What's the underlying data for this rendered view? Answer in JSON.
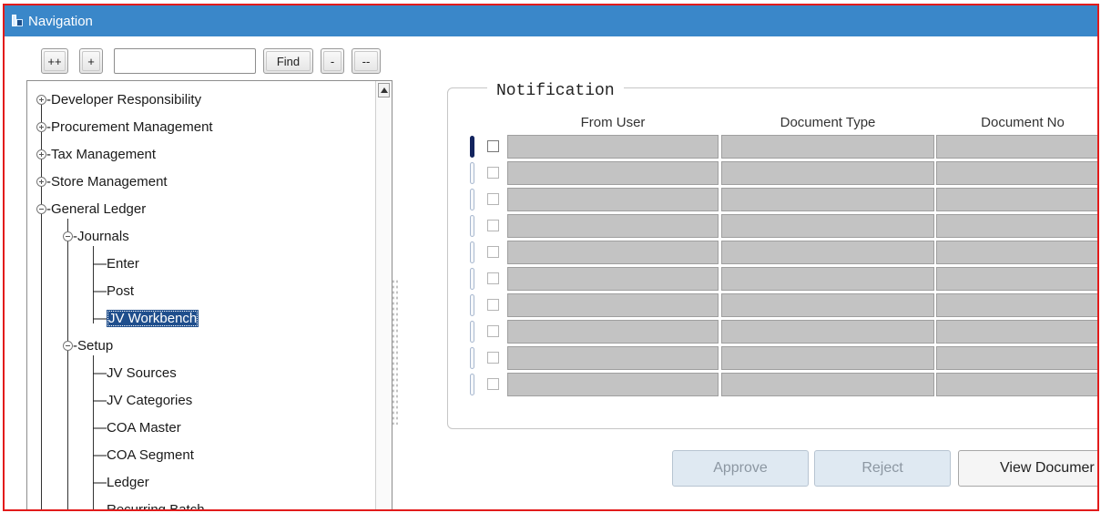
{
  "window": {
    "title": "Navigation"
  },
  "toolbar": {
    "expand_all_label": "++",
    "expand_label": "+",
    "search_value": "",
    "find_label": "Find",
    "collapse_label": "-",
    "collapse_all_label": "--"
  },
  "tree": {
    "items": [
      {
        "label": "Developer Responsibility"
      },
      {
        "label": "Procurement Management"
      },
      {
        "label": "Tax Management"
      },
      {
        "label": "Store Management"
      },
      {
        "label": "General Ledger"
      },
      {
        "label": "Journals"
      },
      {
        "label": "Enter"
      },
      {
        "label": "Post"
      },
      {
        "label": "JV Workbench"
      },
      {
        "label": "Setup"
      },
      {
        "label": "JV Sources"
      },
      {
        "label": "JV Categories"
      },
      {
        "label": "COA Master"
      },
      {
        "label": "COA Segment"
      },
      {
        "label": "Ledger"
      },
      {
        "label": "Recurring Batch"
      }
    ],
    "selected": "JV Workbench"
  },
  "notification": {
    "title": "Notification",
    "columns": [
      "From User",
      "Document Type",
      "Document No"
    ],
    "row_count": 10
  },
  "actions": {
    "approve_label": "Approve",
    "reject_label": "Reject",
    "view_label": "View Documer"
  }
}
